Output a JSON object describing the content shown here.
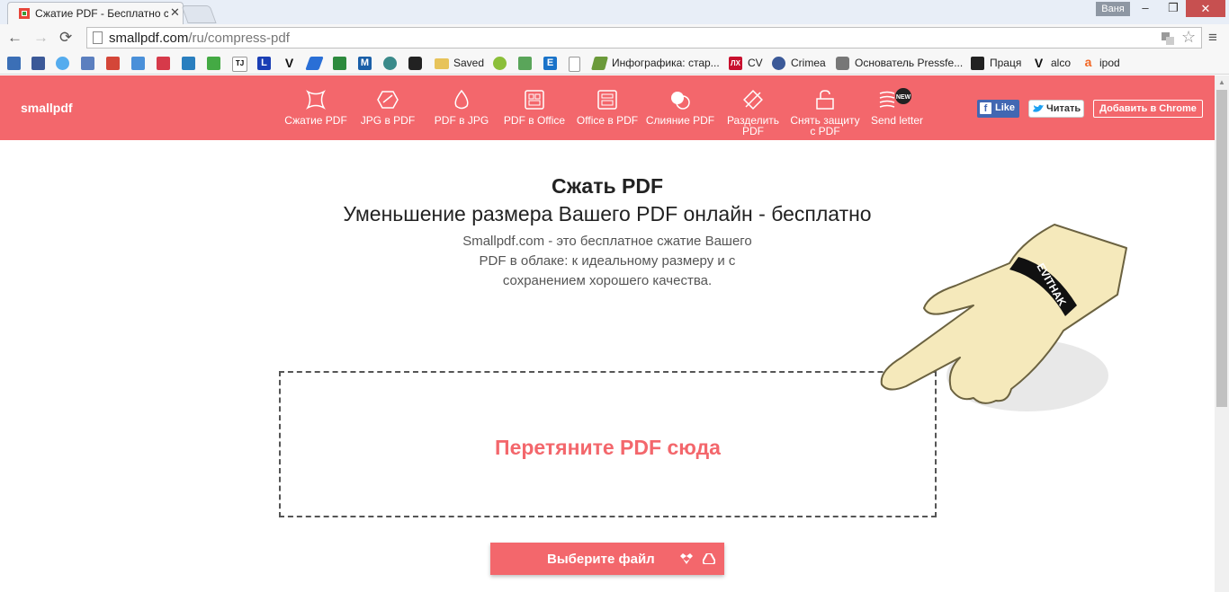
{
  "browser": {
    "tab_title": "Сжатие PDF - Бесплатно с",
    "tab_close": "✕",
    "user_name": "Ваня",
    "window_minimize": "–",
    "window_restore": "❐",
    "window_close": "✕",
    "back_glyph": "←",
    "forward_glyph": "→",
    "reload_glyph": "⟳",
    "menu_glyph": "≡",
    "star_glyph": "☆",
    "url_domain": "smallpdf.com",
    "url_path": "/ru/compress-pdf",
    "bookmarks": [
      {
        "label": "Saved",
        "icon": "folder-icon"
      },
      {
        "label": "Инфографика: стар...",
        "icon": "infographic-icon"
      },
      {
        "label": "CV",
        "icon": "cv-icon"
      },
      {
        "label": "Crimea",
        "icon": "crimea-icon"
      },
      {
        "label": "Основатель Pressfe...",
        "icon": "pressfeed-icon"
      },
      {
        "label": "Праця",
        "icon": "pracya-icon"
      },
      {
        "label": "alco",
        "icon": "alco-icon"
      },
      {
        "label": "ipod",
        "icon": "ipod-icon"
      }
    ],
    "bookmark_icon_letters": {
      "tj": "ТЈ",
      "l": "L",
      "v": "V",
      "m": "M",
      "e": "E",
      "lx": "ЛХ",
      "v2": "V",
      "a": "a"
    }
  },
  "site": {
    "logo": "smallpdf",
    "nav": [
      {
        "label": "Сжатие PDF",
        "icon": "compress-icon"
      },
      {
        "label": "JPG в PDF",
        "icon": "jpg-to-pdf-icon"
      },
      {
        "label": "PDF в JPG",
        "icon": "pdf-to-jpg-icon"
      },
      {
        "label": "PDF в Office",
        "icon": "pdf-to-office-icon"
      },
      {
        "label": "Office в PDF",
        "icon": "office-to-pdf-icon"
      },
      {
        "label": "Слияние PDF",
        "icon": "merge-icon"
      },
      {
        "label": "Разделить PDF",
        "icon": "split-icon"
      },
      {
        "label": "Снять защиту с PDF",
        "icon": "unlock-icon"
      },
      {
        "label": "Send letter",
        "icon": "send-letter-icon",
        "badge": "NEW"
      }
    ],
    "fb_like": "Like",
    "tw_follow": "Читать",
    "add_chrome": "Добавить в Chrome"
  },
  "main": {
    "title": "Сжать PDF",
    "subtitle": "Уменьшение размера Вашего PDF онлайн - бесплатно",
    "description_lines": [
      "Smallpdf.com - это бесплатное сжатие Вашего",
      "PDF в облаке: к идеальному размеру и с",
      "сохранением хорошего качества."
    ],
    "drop_text": "Перетяните PDF сюда",
    "choose_button": "Выберите файл",
    "wristband_text": "EVITHAK"
  },
  "colors": {
    "brand": "#f3676c",
    "text_dark": "#222222",
    "text_muted": "#555555"
  }
}
